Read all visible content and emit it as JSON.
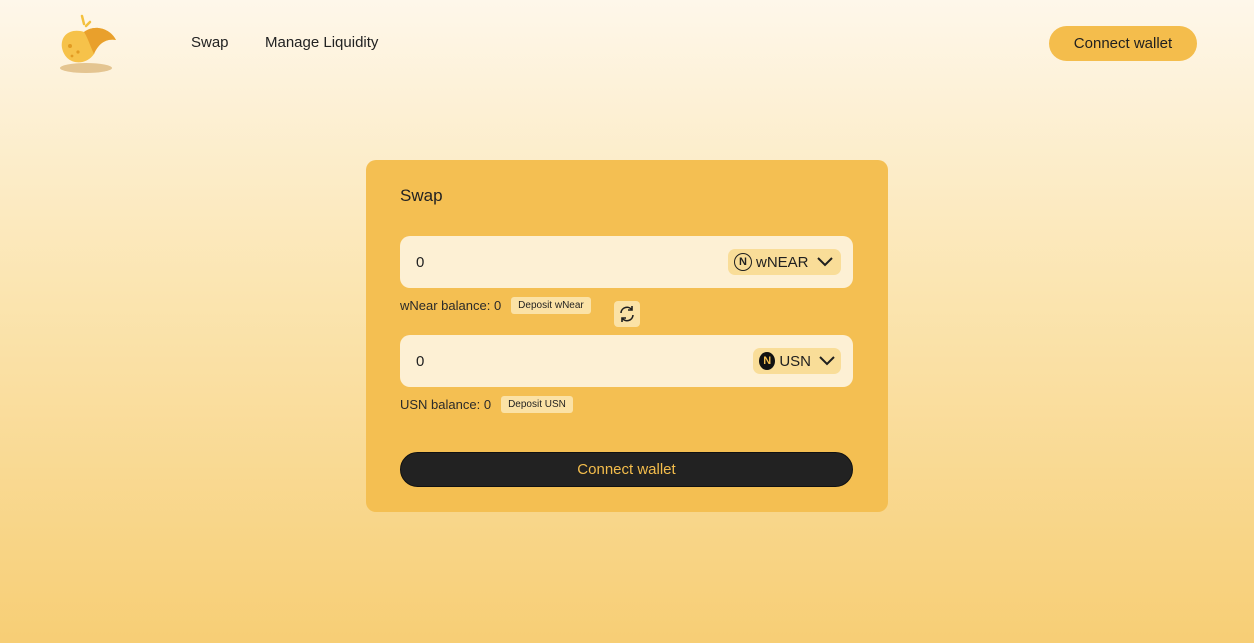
{
  "header": {
    "logo_icon": "taco-logo-icon",
    "nav": [
      {
        "label": "Swap"
      },
      {
        "label": "Manage Liquidity"
      }
    ],
    "connect_label": "Connect wallet"
  },
  "swap": {
    "title": "Swap",
    "from": {
      "amount": "0",
      "token": "wNEAR",
      "token_icon": "near-icon",
      "balance_text": "wNear balance: 0",
      "deposit_label": "Deposit wNear"
    },
    "switch_icon": "swap-arrows-icon",
    "to": {
      "amount": "0",
      "token": "USN",
      "token_icon": "usn-icon",
      "balance_text": "USN balance: 0",
      "deposit_label": "Deposit USN"
    },
    "connect_label": "Connect wallet"
  },
  "colors": {
    "accent": "#f4bd4c",
    "card": "#f4bf52",
    "field": "#fdf0d4",
    "dark_button": "#222222"
  }
}
